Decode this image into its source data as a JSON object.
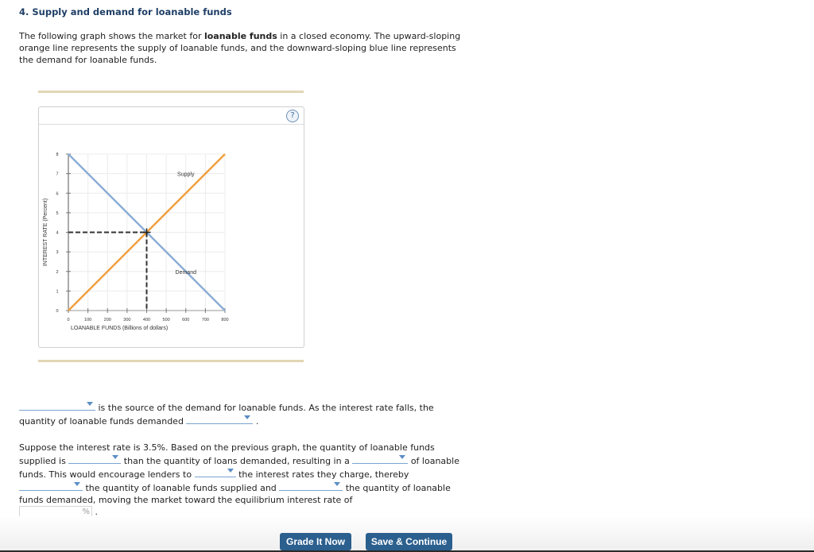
{
  "question": {
    "title": "4. Supply and demand for loanable funds",
    "intro_1": "The following graph shows the market for ",
    "intro_bold": "loanable funds",
    "intro_2": " in a closed economy. The upward-sloping orange line represents the supply of loanable funds, and the downward-sloping blue line represents the demand for loanable funds."
  },
  "help_icon": "?",
  "chart_data": {
    "type": "line",
    "title": "",
    "xlabel": "LOANABLE FUNDS (Billions of dollars)",
    "ylabel": "INTEREST RATE (Percent)",
    "xlim": [
      0,
      800
    ],
    "ylim": [
      0,
      8
    ],
    "x_ticks": [
      0,
      100,
      200,
      300,
      400,
      500,
      600,
      700,
      800
    ],
    "y_ticks": [
      0,
      1,
      2,
      3,
      4,
      5,
      6,
      7,
      8
    ],
    "grid": true,
    "series": [
      {
        "name": "Supply",
        "color": "#f0a040",
        "points": [
          [
            0,
            0
          ],
          [
            800,
            8
          ]
        ],
        "label_at": [
          600,
          7
        ]
      },
      {
        "name": "Demand",
        "color": "#8aaed6",
        "points": [
          [
            0,
            8
          ],
          [
            800,
            0
          ]
        ],
        "label_at": [
          600,
          2
        ]
      }
    ],
    "equilibrium": {
      "x": 400,
      "y": 4,
      "marker": "cross",
      "dashed_guides": true
    }
  },
  "part1": {
    "text_a": " is the source of the demand for loanable funds. As the interest rate falls, the quantity of loanable funds demanded ",
    "text_b": " ."
  },
  "part2": {
    "s1": "Suppose the interest rate is 3.5%. Based on the previous graph, the quantity of loanable funds supplied is ",
    "s2": " than the quantity of loans demanded, resulting in a ",
    "s3": " of loanable funds. This would encourage lenders to ",
    "s4": " the interest rates they charge, thereby ",
    "s5": " the quantity of loanable funds supplied and ",
    "s6": " the quantity of loanable funds demanded, moving the market toward the equilibrium interest rate of",
    "pct_unit": "%",
    "end": " ."
  },
  "buttons": {
    "grade": "Grade It Now",
    "save": "Save & Continue"
  }
}
